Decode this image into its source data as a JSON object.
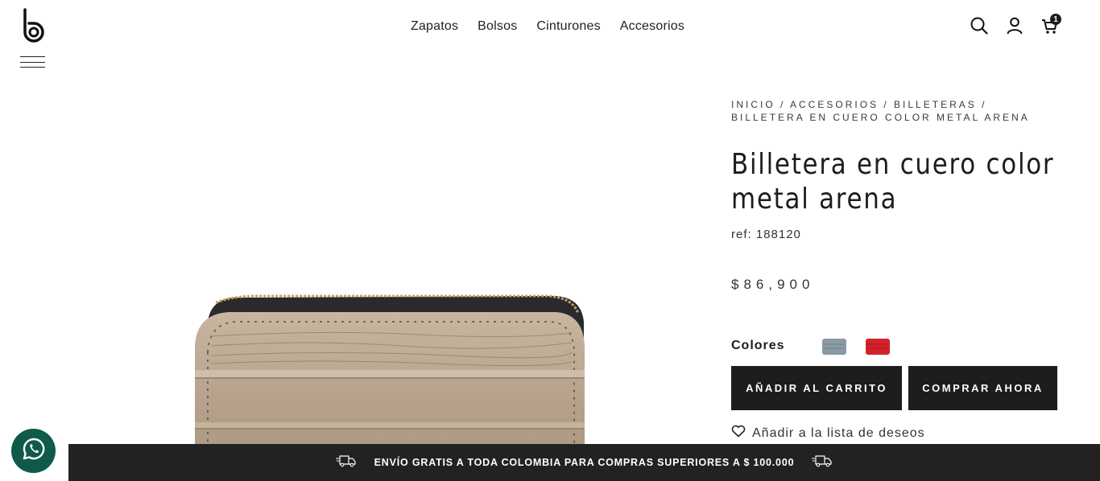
{
  "header": {
    "nav": [
      {
        "label": "Zapatos"
      },
      {
        "label": "Bolsos"
      },
      {
        "label": "Cinturones"
      },
      {
        "label": "Accesorios"
      }
    ],
    "cart_count": "1"
  },
  "breadcrumb": {
    "items": [
      "INICIO",
      "ACCESORIOS",
      "BILLETERAS",
      "BILLETERA EN CUERO COLOR METAL ARENA"
    ],
    "separator": " / "
  },
  "product": {
    "title": "Billetera en cuero color metal arena",
    "ref": "ref: 188120",
    "price": "$86,900",
    "colors_label": "Colores",
    "swatches": [
      {
        "name": "gris azulado",
        "color": "#8a9ba6"
      },
      {
        "name": "rojo",
        "color": "#d3222b"
      }
    ],
    "main_color": "#b9a58f"
  },
  "actions": {
    "add_to_cart": "AÑADIR AL CARRITO",
    "buy_now": "COMPRAR AHORA",
    "wishlist": "Añadir a la lista de deseos"
  },
  "shipping_bar": {
    "text": "ENVÍO GRATIS A TODA COLOMBIA PARA COMPRAS SUPERIORES A $ 100.000"
  },
  "colors": {
    "dark": "#1d1d1d",
    "whatsapp": "#0f5a4a"
  }
}
